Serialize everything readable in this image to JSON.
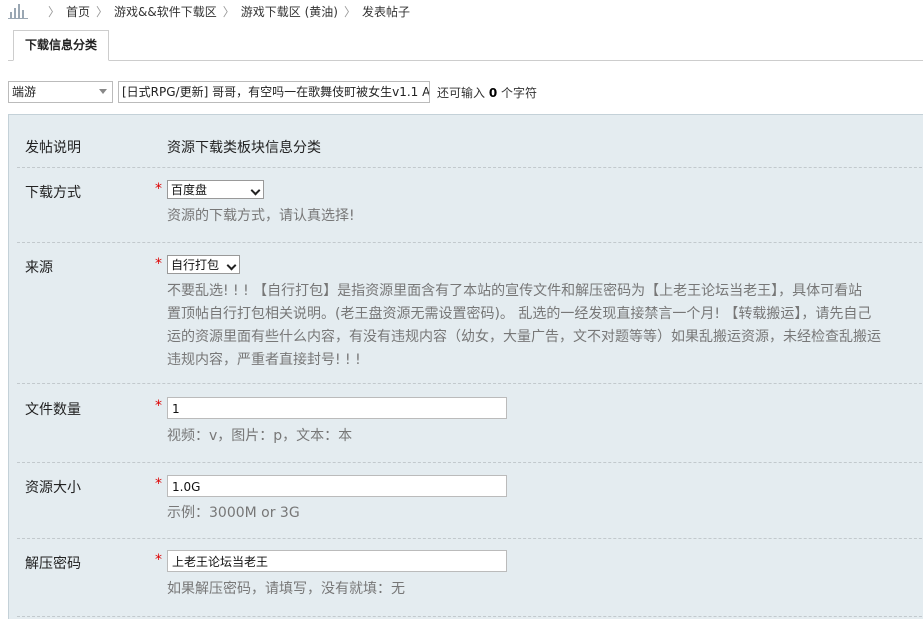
{
  "breadcrumb": {
    "home_icon": "bar-chart-icon",
    "items": [
      "首页",
      "游戏&&软件下载区",
      "游戏下载区 (黄油)",
      "发表帖子"
    ],
    "separator": "〉"
  },
  "tabs": {
    "active_label": "下载信息分类"
  },
  "subject": {
    "category_select": "端游",
    "title_value": "[日式RPG/更新] 哥哥，有空吗一在歌舞伎町被女生v1.1 A",
    "remaining_prefix": "还可输入",
    "remaining_count": "0",
    "remaining_suffix": "个字符"
  },
  "form": {
    "intro": {
      "label": "发帖说明",
      "value": "资源下载类板块信息分类"
    },
    "download_method": {
      "label": "下载方式",
      "required": "*",
      "selected": "百度盘",
      "hint": "资源的下载方式，请认真选择!"
    },
    "source": {
      "label": "来源",
      "required": "*",
      "selected": "自行打包",
      "hint_lines": [
        "不要乱选! ! ! 【自行打包】是指资源里面含有了本站的宣传文件和解压密码为【上老王论坛当老王】，具体可看站",
        "置顶帖自行打包相关说明。(老王盘资源无需设置密码)。 乱选的一经发现直接禁言一个月! 【转载搬运】，请先自己",
        "运的资源里面有些什么内容，有没有违规内容（幼女，大量广告，文不对题等等）如果乱搬运资源，未经检查乱搬运",
        "违规内容，严重者直接封号! ! !"
      ]
    },
    "file_count": {
      "label": "文件数量",
      "required": "*",
      "value": "1",
      "hint": "视频：v，图片：p，文本：本"
    },
    "resource_size": {
      "label": "资源大小",
      "required": "*",
      "value": "1.0G",
      "hint": "示例：3000M or 3G"
    },
    "unzip_password": {
      "label": "解压密码",
      "required": "*",
      "value": "上老王论坛当老王",
      "hint": "如果解压密码，请填写，没有就填：无"
    }
  },
  "colors": {
    "panel_bg": "#e4ecf0",
    "required": "#dd0000",
    "hint_text": "#777777"
  }
}
